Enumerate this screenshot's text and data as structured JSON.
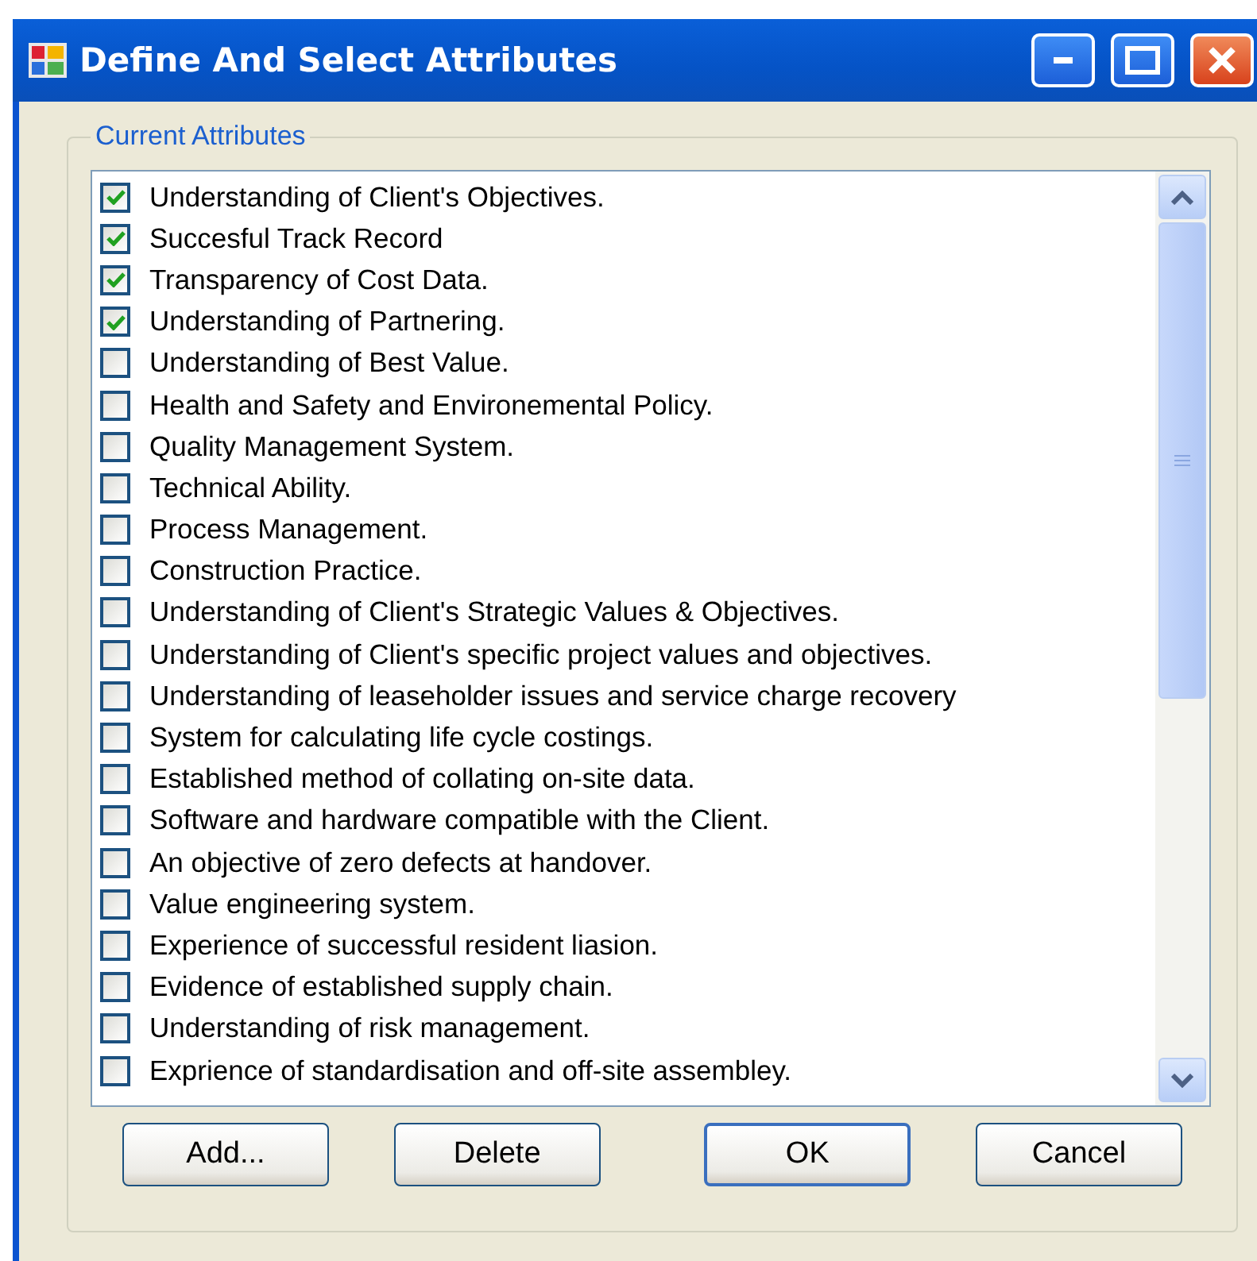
{
  "window": {
    "title": "Define And Select Attributes"
  },
  "group": {
    "label": "Current Attributes"
  },
  "items": [
    {
      "label": "Understanding of Client's Objectives.",
      "checked": true
    },
    {
      "label": "Succesful Track Record",
      "checked": true
    },
    {
      "label": "Transparency of Cost Data.",
      "checked": true
    },
    {
      "label": "Understanding of Partnering.",
      "checked": true
    },
    {
      "label": "Understanding of Best Value.",
      "checked": false
    },
    {
      "label": "Health and Safety and Environemental Policy.",
      "checked": false
    },
    {
      "label": "Quality Management System.",
      "checked": false
    },
    {
      "label": "Technical Ability.",
      "checked": false
    },
    {
      "label": "Process Management.",
      "checked": false
    },
    {
      "label": "Construction Practice.",
      "checked": false
    },
    {
      "label": "Understanding of Client's Strategic Values & Objectives.",
      "checked": false
    },
    {
      "label": "Understanding of Client's specific project values and objectives.",
      "checked": false
    },
    {
      "label": "Understanding of leaseholder issues and service charge recovery",
      "checked": false
    },
    {
      "label": "System for calculating life cycle costings.",
      "checked": false
    },
    {
      "label": "Established method of collating on-site data.",
      "checked": false
    },
    {
      "label": "Software and hardware compatible with the Client.",
      "checked": false
    },
    {
      "label": "An objective of zero defects at handover.",
      "checked": false
    },
    {
      "label": "Value engineering system.",
      "checked": false
    },
    {
      "label": "Experience of successful resident liasion.",
      "checked": false
    },
    {
      "label": "Evidence of established supply chain.",
      "checked": false
    },
    {
      "label": "Understanding of risk management.",
      "checked": false
    },
    {
      "label": "Exprience of standardisation and off-site assembley.",
      "checked": false
    }
  ],
  "buttons": [
    {
      "label": "Add...",
      "default": false
    },
    {
      "label": "Delete",
      "default": false
    },
    {
      "label": "OK",
      "default": true
    },
    {
      "label": "Cancel",
      "default": false
    }
  ]
}
